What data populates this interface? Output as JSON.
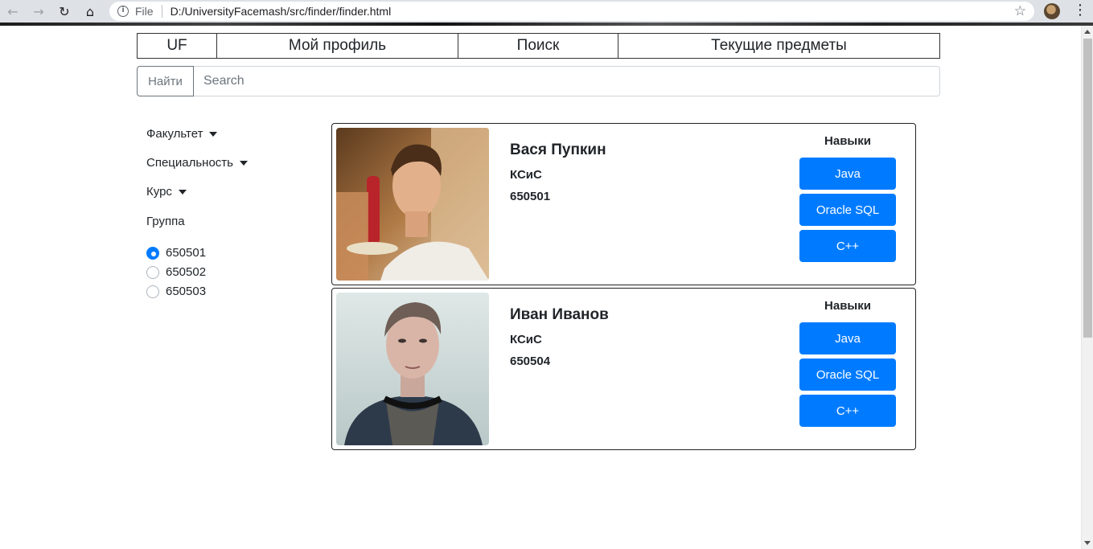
{
  "browser": {
    "scheme": "File",
    "url": "D:/UniversityFacemash/src/finder/finder.html"
  },
  "nav": [
    "UF",
    "Мой профиль",
    "Поиск",
    "Текущие предметы"
  ],
  "search": {
    "button_label": "Найти",
    "placeholder": "Search"
  },
  "filters": {
    "faculty_label": "Факультет",
    "specialty_label": "Специальность",
    "course_label": "Курс",
    "group_label": "Группа",
    "groups": [
      "650501",
      "650502",
      "650503"
    ],
    "selected_group": "650501"
  },
  "students": [
    {
      "name": "Вася Пупкин",
      "faculty": "КСиС",
      "group": "650501",
      "skills_title": "Навыки",
      "skills": [
        "Java",
        "Oracle SQL",
        "C++"
      ]
    },
    {
      "name": "Иван Иванов",
      "faculty": "КСиС",
      "group": "650504",
      "skills_title": "Навыки",
      "skills": [
        "Java",
        "Oracle SQL",
        "C++"
      ]
    }
  ],
  "colors": {
    "primary": "#007bff",
    "border": "#222222"
  }
}
